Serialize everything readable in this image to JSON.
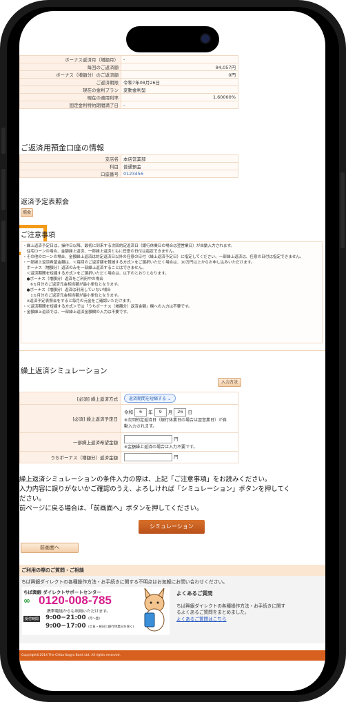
{
  "loan_info": {
    "rows": [
      {
        "label": "ボーナス返済月（増額月）",
        "value": "-"
      },
      {
        "label": "毎回のご返済額",
        "value": "84,057円"
      },
      {
        "label": "ボーナス（増額分）のご返済額",
        "value": "0円"
      },
      {
        "label": "ご返済期限",
        "value": "令和7年08月26日"
      },
      {
        "label": "現在の金利プラン",
        "value": "変動金利型"
      },
      {
        "label": "現在の適用利率",
        "value": "1.60000%"
      },
      {
        "label": "固定金利特約期間満了日",
        "value": "-"
      }
    ]
  },
  "account": {
    "title": "ご返済用預金口座の情報",
    "rows": [
      {
        "label": "支店名",
        "value": "本店営業部"
      },
      {
        "label": "科目",
        "value": "普通預金"
      },
      {
        "label": "口座番号",
        "value": "0123456"
      }
    ]
  },
  "schedule": {
    "title": "返済予定表照会",
    "button": "照会"
  },
  "notes": {
    "title": "ご注意事項",
    "lines": [
      "・繰上返済予定日は、操作日以降、最初に到来する次回約定返済日（銀行休業日の場合は翌営業日）が自動入力されます。",
      "　住宅ローンの場合、金額繰上返済、一部繰上返済ともに任意の日付は指定できません。",
      "・その他のローンの場合、金額繰上返済は約定返済日以外の任意の日付（繰上返済予定日）に指定してください。一部繰上返済は、任意の日付は指定できません。",
      "・一部繰上返済希望金額は、＜毎回のご返済額を軽減する方式＞をご選択いただく場合は、10万円以上からお申し込みいただけます。",
      "　ボーナス（増額分）返済のみを一部繰上返済することはできません。",
      "　＜返済期間を短縮する方式＞をご選択いただく場合は、以下のとおりとなります。",
      "　●ボーナス（増額分）返済をご利用中の場合",
      "　　6ヵ月分のご返済元金相当額が最小単位となります。",
      "　●ボーナス（増額分）返済は利用していない場合",
      "　　1ヵ月分のご返済元金相当額が最小単位となります。",
      "　※返済予定表照会をすると毎月の元金をご確認いただけます。",
      "・＜返済期間を短縮する方式＞では「うちボーナス（増額分）返済金額」欄への入力は不要です。",
      "・金額繰上返済では、一部繰上返済金額欄の入力は不要です。"
    ]
  },
  "simulation": {
    "title": "繰上返済シミュレーション",
    "input_button": "入力方法",
    "method_label": "[必須] 繰上返済方式",
    "method_value": "返済期間を短縮する",
    "date_label": "[必須] 繰上返済予定日",
    "era": "令和",
    "year": "6",
    "year_unit": "年",
    "month": "9",
    "month_unit": "月",
    "day": "26",
    "day_unit": "日",
    "date_note": "※次回約定返済日（銀行休業日の場合は翌営業日）が自動入力されます。",
    "amount_label": "一部繰上返済希望金額",
    "amount_unit": "円",
    "amount_note": "※金額繰上返済の場合は入力不要です。",
    "bonus_label": "うちボーナス（増額分）返済金額",
    "bonus_unit": "円"
  },
  "instructions": {
    "line1": "繰上返済シミュレーションの条件入力の際は、上記「ご注意事項」をお読みください。",
    "line2": "入力内容に誤りがないかご確認のうえ、よろしければ「シミュレーション」ボタンを押してく",
    "line3": "ださい。",
    "line4": "前ページに戻る場合は、「前画面へ」ボタンを押してください。"
  },
  "buttons": {
    "simulate": "シミュレーション",
    "back": "前画面へ"
  },
  "help": {
    "bar": "ご利用の際のご質問・ご相談",
    "intro": "ちば興銀ダイレクトの各種操作方法・お手続きに関する不明点はお気軽にお問い合わせください。",
    "center": "ちば興銀 ダイレクトサポートセンター",
    "phone": "0120-008-785",
    "mobile": "携帯電話からも利用いただけます。",
    "hours_label": "受付時間",
    "hours1": "9:00−21:00",
    "hours1_note": "(月〜金)",
    "hours2": "9:00−17:00",
    "hours2_note": "(土日・祝日と銀行休業日を除く)",
    "faq_title": "よくあるご質問",
    "faq_text1": "ちば興銀ダイレクトの各種操作方法・お手続きに関す",
    "faq_text2": "るよくあるご質問をまとめました。",
    "faq_link": "よくあるご質問はこちら"
  },
  "footer": "Copyright©2014 The Chiba Kogyo Bank Ltd. All rights reserved."
}
